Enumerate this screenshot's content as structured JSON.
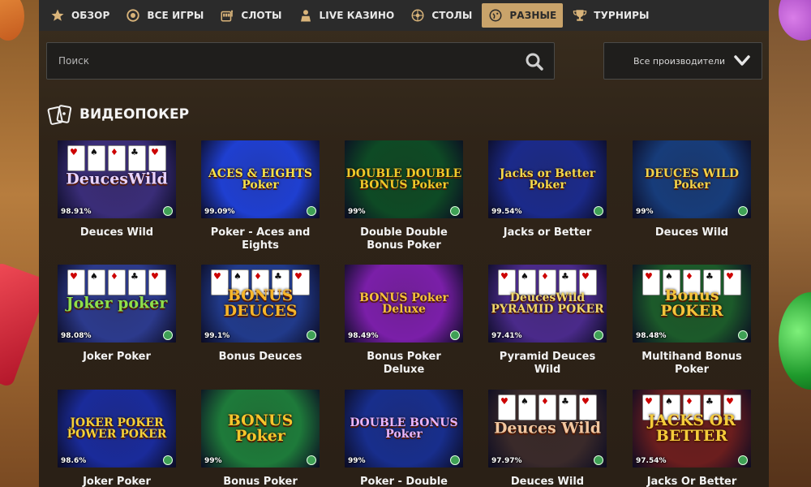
{
  "nav": [
    {
      "label": "ОБЗОР",
      "icon": "star-icon",
      "active": false
    },
    {
      "label": "ВСЕ ИГРЫ",
      "icon": "chip-icon",
      "active": false
    },
    {
      "label": "СЛОТЫ",
      "icon": "slot-machine-icon",
      "active": false
    },
    {
      "label": "LIVE КАЗИНО",
      "icon": "dealer-icon",
      "active": false
    },
    {
      "label": "СТОЛЫ",
      "icon": "roulette-icon",
      "active": false
    },
    {
      "label": "РАЗНЫЕ",
      "icon": "dice-icon",
      "active": true
    },
    {
      "label": "ТУРНИРЫ",
      "icon": "trophy-icon",
      "active": false
    }
  ],
  "search": {
    "placeholder": "Поиск"
  },
  "provider": {
    "label": "Все производители"
  },
  "section": {
    "title": "ВИДЕОПОКЕР"
  },
  "colors": {
    "accent": "#c9a36a",
    "nav_bg": "#2b2b2b",
    "panel_bg": "#2f2418"
  },
  "games": [
    {
      "name": "Deuces Wild",
      "rtp": "98.91%",
      "logo": "DeucesWild",
      "bg": "#3a2d78",
      "logo_color": "#e8d3ff",
      "cards": true
    },
    {
      "name": "Poker - Aces and Eights",
      "rtp": "99.09%",
      "logo": "ACES & EIGHTS Poker",
      "bg": "#1f3fd0",
      "logo_color": "#f5e14a",
      "cards": false
    },
    {
      "name": "Double Double Bonus Poker",
      "rtp": "99%",
      "logo": "DOUBLE DOUBLE BONUS Poker",
      "bg": "#0e4a25",
      "logo_color": "#f0c92a",
      "cards": false
    },
    {
      "name": "Jacks or Better",
      "rtp": "99.54%",
      "logo": "Jacks or Better Poker",
      "bg": "#1b2a8a",
      "logo_color": "#f3d84a",
      "cards": false
    },
    {
      "name": "Deuces Wild",
      "rtp": "99%",
      "logo": "DEUCES WILD Poker",
      "bg": "#173c7a",
      "logo_color": "#f2d24a",
      "cards": false
    },
    {
      "name": "Joker Poker",
      "rtp": "98.08%",
      "logo": "Joker poker",
      "bg": "#2c3a8c",
      "logo_color": "#8fe04a",
      "cards": true
    },
    {
      "name": "Bonus Deuces",
      "rtp": "99.1%",
      "logo": "BONUS DEUCES",
      "bg": "#213a8a",
      "logo_color": "#f6b52b",
      "cards": true
    },
    {
      "name": "Bonus Poker Deluxe",
      "rtp": "98.49%",
      "logo": "BONUS Poker Deluxe",
      "bg": "#7a1fa8",
      "logo_color": "#f7c23a",
      "cards": false
    },
    {
      "name": "Pyramid Deuces Wild",
      "rtp": "97.41%",
      "logo": "DeucesWild PYRAMID POKER",
      "bg": "#4a2a8a",
      "logo_color": "#f0d76a",
      "cards": true
    },
    {
      "name": "Multihand Bonus Poker",
      "rtp": "98.48%",
      "logo": "Bonus POKER",
      "bg": "#1c5a2a",
      "logo_color": "#f3c43a",
      "cards": true
    },
    {
      "name": "Joker Poker",
      "rtp": "98.6%",
      "logo": "JOKER POKER POWER POKER",
      "bg": "#1a2b9a",
      "logo_color": "#f5d13a",
      "cards": false
    },
    {
      "name": "Bonus Poker",
      "rtp": "99%",
      "logo": "BONUS Poker",
      "bg": "#1e7a3a",
      "logo_color": "#f5c52c",
      "cards": false
    },
    {
      "name": "Poker - Double Bonus",
      "rtp": "99%",
      "logo": "DOUBLE BONUS Poker",
      "bg": "#182e8c",
      "logo_color": "#e8b5ff",
      "cards": false
    },
    {
      "name": "Deuces Wild",
      "rtp": "97.97%",
      "logo": "Deuces Wild",
      "bg": "#3a2a2a",
      "logo_color": "#f2c7a0",
      "cards": true
    },
    {
      "name": "Jacks Or Better",
      "rtp": "97.54%",
      "logo": "JACKS OR BETTER",
      "bg": "#6b1e1e",
      "logo_color": "#f5cc3a",
      "cards": true
    }
  ]
}
